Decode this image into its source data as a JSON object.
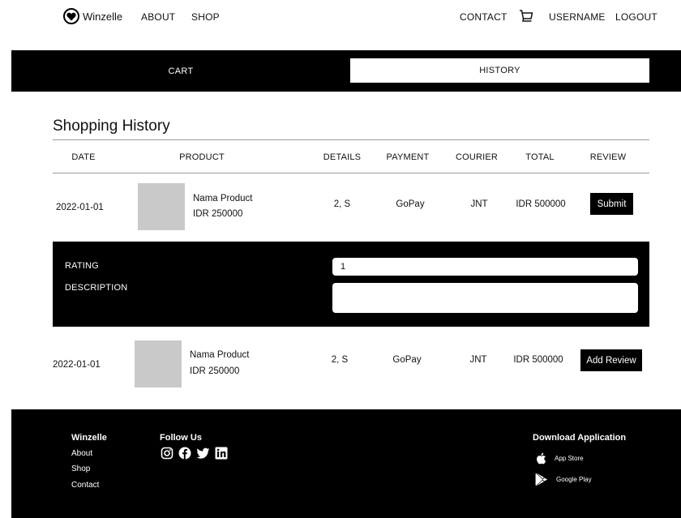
{
  "header": {
    "brand": "Winzelle",
    "nav_about": "ABOUT",
    "nav_shop": "SHOP",
    "nav_contact": "CONTACT",
    "nav_username": "USERNAME",
    "nav_logout": "LOGOUT"
  },
  "tabs": {
    "cart": "CART",
    "history": "HISTORY",
    "active": "HISTORY"
  },
  "page": {
    "title": "Shopping History"
  },
  "table": {
    "columns": [
      "DATE",
      "PRODUCT",
      "DETAILS",
      "PAYMENT",
      "COURIER",
      "TOTAL",
      "REVIEW"
    ],
    "rows": [
      {
        "date": "2022-01-01",
        "product_name": "Nama Product",
        "product_price": "IDR 250000",
        "details": "2, S",
        "payment": "GoPay",
        "courier": "JNT",
        "total": "IDR 500000",
        "review_button": "Submit"
      },
      {
        "date": "2022-01-01",
        "product_name": "Nama Product",
        "product_price": "IDR 250000",
        "details": "2, S",
        "payment": "GoPay",
        "courier": "JNT",
        "total": "IDR 500000",
        "review_button": "Add Review"
      }
    ]
  },
  "review_form": {
    "rating_label": "RATING",
    "rating_value": "1",
    "description_label": "DESCRIPTION",
    "description_value": ""
  },
  "footer": {
    "brand": "Winzelle",
    "links": [
      "About",
      "Shop",
      "Contact"
    ],
    "follow_heading": "Follow Us",
    "social_icons": [
      "instagram-icon",
      "facebook-icon",
      "twitter-icon",
      "linkedin-icon"
    ],
    "download_heading": "Download Application",
    "app_store": "App Store",
    "google_play": "Google Play"
  },
  "colors": {
    "primary": "#000000",
    "background": "#ffffff",
    "thumbnail": "#c9c9c9"
  }
}
